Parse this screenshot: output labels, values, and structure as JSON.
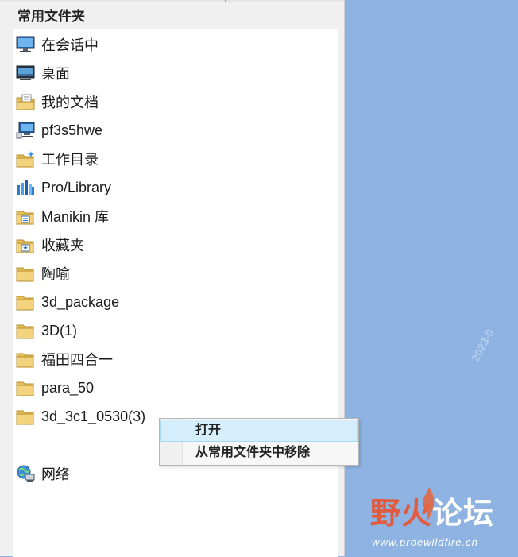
{
  "panel": {
    "title": "常用文件夹",
    "items": [
      {
        "label": "在会话中",
        "icon": "monitor-icon"
      },
      {
        "label": "桌面",
        "icon": "desktop-icon"
      },
      {
        "label": "我的文档",
        "icon": "documents-folder-icon"
      },
      {
        "label": "pf3s5hwe",
        "icon": "computer-icon"
      },
      {
        "label": "工作目录",
        "icon": "working-folder-icon"
      },
      {
        "label": "Pro/Library",
        "icon": "library-icon"
      },
      {
        "label": "Manikin 库",
        "icon": "manikin-folder-icon"
      },
      {
        "label": "收藏夹",
        "icon": "favorites-folder-icon"
      },
      {
        "label": "陶喻",
        "icon": "folder-icon"
      },
      {
        "label": "3d_package",
        "icon": "folder-icon"
      },
      {
        "label": "3D(1)",
        "icon": "folder-icon"
      },
      {
        "label": "福田四合一",
        "icon": "folder-icon"
      },
      {
        "label": "para_50",
        "icon": "folder-icon"
      },
      {
        "label": "3d_3c1_0530(3)",
        "icon": "folder-icon"
      }
    ],
    "network": {
      "label": "网络",
      "icon": "network-icon"
    }
  },
  "context_menu": {
    "items": [
      {
        "label": "打开"
      },
      {
        "label": "从常用文件夹中移除"
      }
    ]
  },
  "logo": {
    "brand_1": "野",
    "brand_2": "火",
    "brand_3": "论坛",
    "url": "www.proewildfire.cn"
  },
  "watermark": "2023-0",
  "colors": {
    "desktop_bg": "#8eb3e3",
    "menu_hover": "#d5eefc",
    "folder": "#f3d37d",
    "brand_red": "#e15b3c"
  }
}
